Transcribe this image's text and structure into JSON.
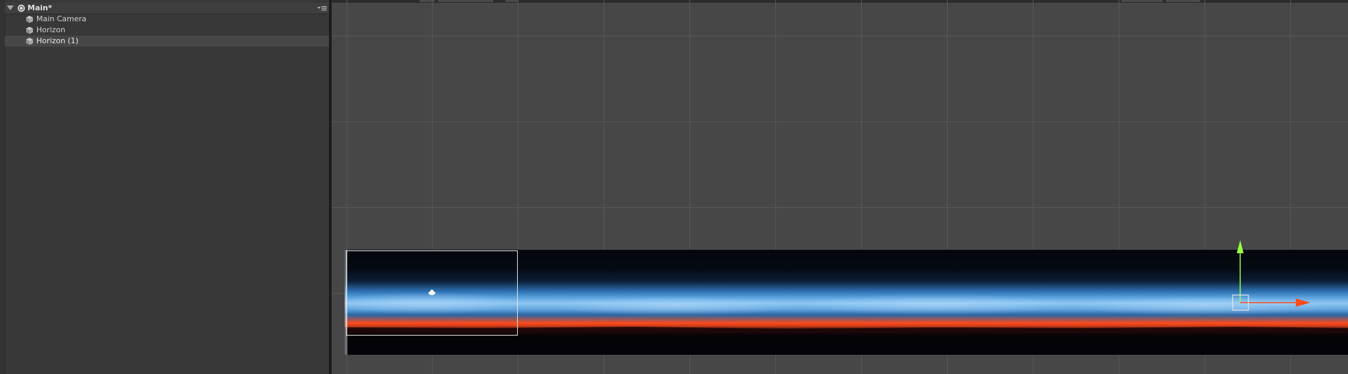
{
  "hierarchy": {
    "scene_name": "Main*",
    "items": [
      {
        "label": "Main Camera",
        "selected": false
      },
      {
        "label": "Horizon",
        "selected": false
      },
      {
        "label": "Horizon (1)",
        "selected": true
      }
    ]
  },
  "scene_view": {
    "grid_line_color": "#5a5a5a",
    "background": "#474747",
    "gizmo": {
      "y_axis_color": "#9cff40",
      "x_axis_color": "#ff4a1a"
    }
  },
  "icons": {
    "foldout": "triangle-down-icon",
    "scene": "unity-logo-icon",
    "menu": "context-menu-icon",
    "game_object": "cube-icon"
  }
}
